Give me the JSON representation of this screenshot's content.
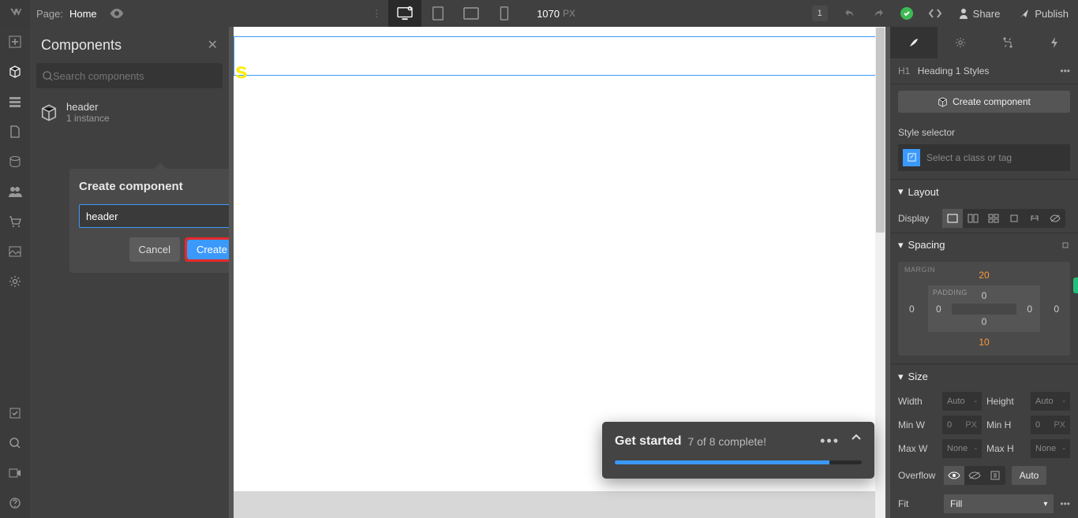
{
  "topbar": {
    "page_label": "Page:",
    "page_name": "Home",
    "canvas_width": "1070",
    "canvas_unit": "PX",
    "badge": "1",
    "share_label": "Share",
    "publish_label": "Publish"
  },
  "components": {
    "title": "Components",
    "search_placeholder": "Search components",
    "item": {
      "name": "header",
      "instances": "1 instance"
    },
    "dialog": {
      "title": "Create component",
      "input_value": "header",
      "cancel": "Cancel",
      "create": "Create"
    }
  },
  "canvas": {
    "s_text": "s"
  },
  "toast": {
    "title": "Get started",
    "subtitle": "7 of 8 complete!",
    "progress_pct": 87
  },
  "rightpanel": {
    "selection_tag": "H1",
    "selection_label": "Heading 1 Styles",
    "create_component": "Create component",
    "style_selector_label": "Style selector",
    "selector_placeholder": "Select a class or tag",
    "layout_label": "Layout",
    "display_label": "Display",
    "spacing_label": "Spacing",
    "margin_label": "MARGIN",
    "padding_label": "PADDING",
    "margin": {
      "top": "20",
      "right": "0",
      "bottom": "10",
      "left": "0"
    },
    "padding": {
      "top": "0",
      "right": "0",
      "bottom": "0",
      "left": "0"
    },
    "size_label": "Size",
    "width_label": "Width",
    "height_label": "Height",
    "minw_label": "Min W",
    "minh_label": "Min H",
    "maxw_label": "Max W",
    "maxh_label": "Max H",
    "auto": "Auto",
    "none": "None",
    "zero": "0",
    "px": "PX",
    "dash": "-",
    "overflow_label": "Overflow",
    "auto_btn": "Auto",
    "fit_label": "Fit",
    "fit_value": "Fill"
  }
}
